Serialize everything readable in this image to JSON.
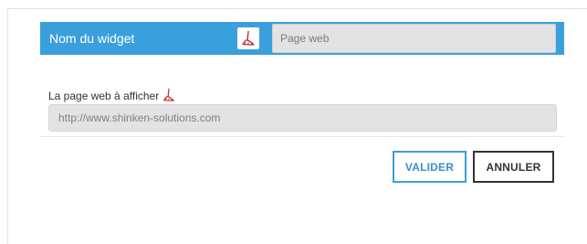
{
  "widget_name": {
    "label": "Nom du widget",
    "placeholder": "Page web",
    "value": "",
    "reset_icon": "broom-icon"
  },
  "url_field": {
    "label": "La page web à afficher",
    "placeholder": "http://www.shinken-solutions.com",
    "value": "",
    "reset_icon": "broom-icon"
  },
  "actions": {
    "validate_label": "VALIDER",
    "cancel_label": "ANNULER"
  },
  "colors": {
    "accent": "#3aa0db",
    "icon": "#c4302b",
    "input_bg": "#e3e3e3"
  }
}
